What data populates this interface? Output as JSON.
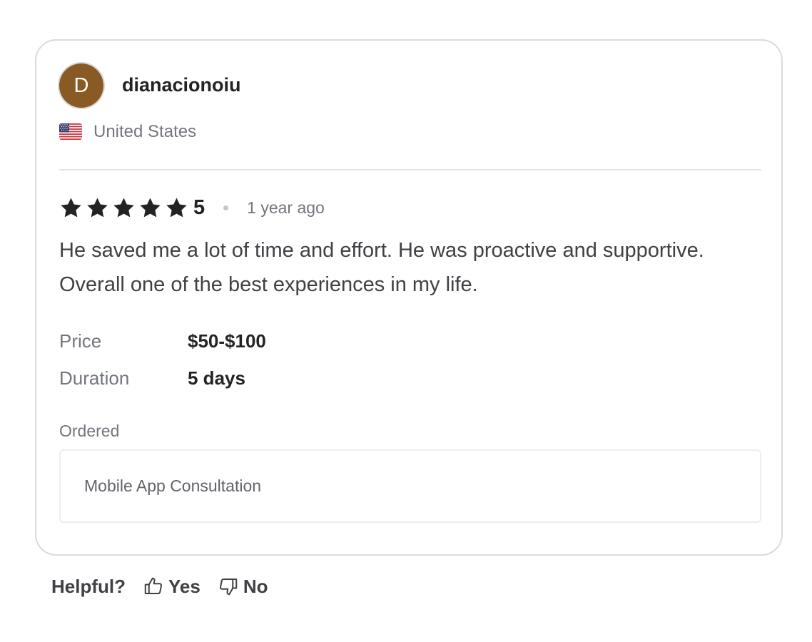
{
  "reviewer": {
    "avatar_initial": "D",
    "avatar_color": "#8a5a24",
    "name": "dianacionoiu",
    "country": "United States",
    "flag_icon": "us-flag-icon"
  },
  "rating": {
    "stars_filled": 5,
    "stars_total": 5,
    "value": "5",
    "time_ago": "1 year ago",
    "star_color": "#222325"
  },
  "review": {
    "text": "He saved me a lot of time and effort. He was proactive and supportive. Overall one of the best experiences in my life."
  },
  "details": {
    "price_label": "Price",
    "price_value": "$50-$100",
    "duration_label": "Duration",
    "duration_value": "5 days"
  },
  "ordered": {
    "label": "Ordered",
    "item": "Mobile App Consultation"
  },
  "helpful": {
    "label": "Helpful?",
    "yes_label": "Yes",
    "no_label": "No",
    "yes_icon": "thumbs-up-icon",
    "no_icon": "thumbs-down-icon"
  }
}
